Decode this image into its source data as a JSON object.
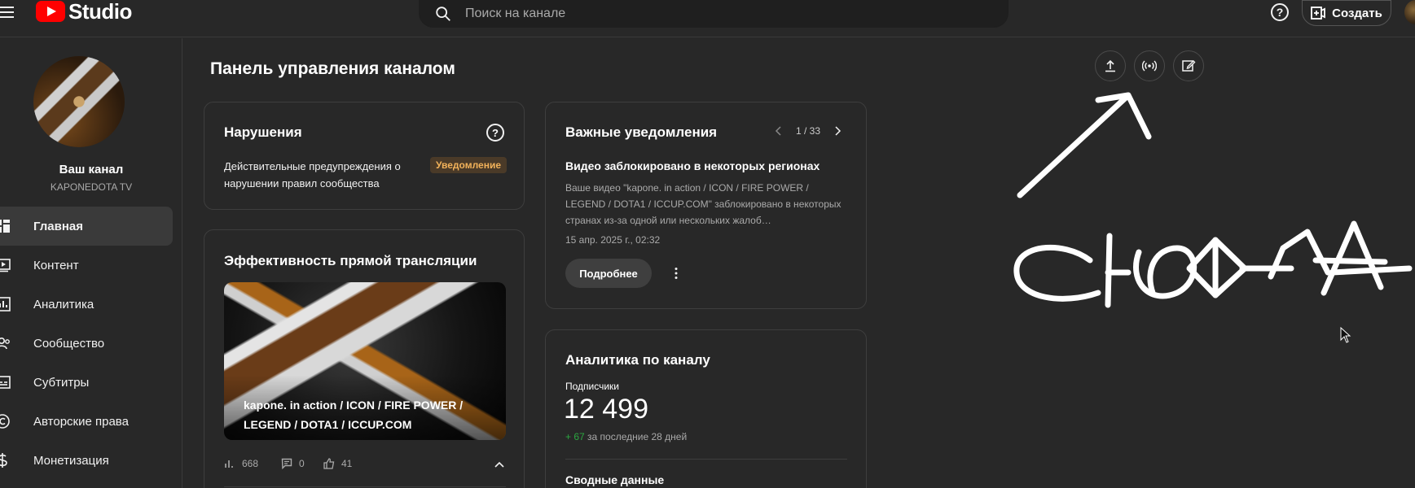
{
  "app": {
    "logo_text": "Studio",
    "brand_color": "#ff0000"
  },
  "header": {
    "search_placeholder": "Поиск на канале",
    "help_label": "?",
    "create_label": "Создать"
  },
  "channel": {
    "title": "Ваш канал",
    "handle": "KAPONEDOTA TV"
  },
  "sidebar": {
    "items": [
      {
        "label": "Главная",
        "icon": "dashboard-icon",
        "active": true
      },
      {
        "label": "Контент",
        "icon": "content-icon"
      },
      {
        "label": "Аналитика",
        "icon": "analytics-icon"
      },
      {
        "label": "Сообщество",
        "icon": "community-icon"
      },
      {
        "label": "Субтитры",
        "icon": "subtitles-icon"
      },
      {
        "label": "Авторские права",
        "icon": "copyright-icon"
      },
      {
        "label": "Монетизация",
        "icon": "monetization-icon"
      }
    ]
  },
  "main": {
    "title": "Панель управления каналом"
  },
  "violations": {
    "title": "Нарушения",
    "description": "Действительные предупреждения о нарушении правил сообщества",
    "badge": "Уведомление",
    "badge_color": "#f2b25a"
  },
  "live": {
    "title": "Эффективность прямой трансляции",
    "video_title": "kapone. in action / ICON / FIRE POWER / LEGEND / DOTA1 / ICCUP.COM",
    "views": "668",
    "comments": "0",
    "likes": "41"
  },
  "notifications": {
    "title": "Важные уведомления",
    "pager": "1 / 33",
    "item_title": "Видео заблокировано в некоторых регионах",
    "item_body": "Ваше видео \"kapone. in action / ICON / FIRE POWER / LEGEND / DOTA1 / ICCUP.COM\" заблокировано в некоторых странах из-за одной или нескольких жалоб…",
    "item_date": "15 апр. 2025 г., 02:32",
    "details_label": "Подробнее"
  },
  "analytics": {
    "title": "Аналитика по каналу",
    "subs_label": "Подписчики",
    "subs_count": "12 499",
    "subs_delta": "+ 67",
    "subs_period": "за последние 28 дней",
    "summary_title": "Сводные данные",
    "positive_color": "#2ba640"
  },
  "annotation": {
    "handwritten_text": "СЮДА"
  }
}
